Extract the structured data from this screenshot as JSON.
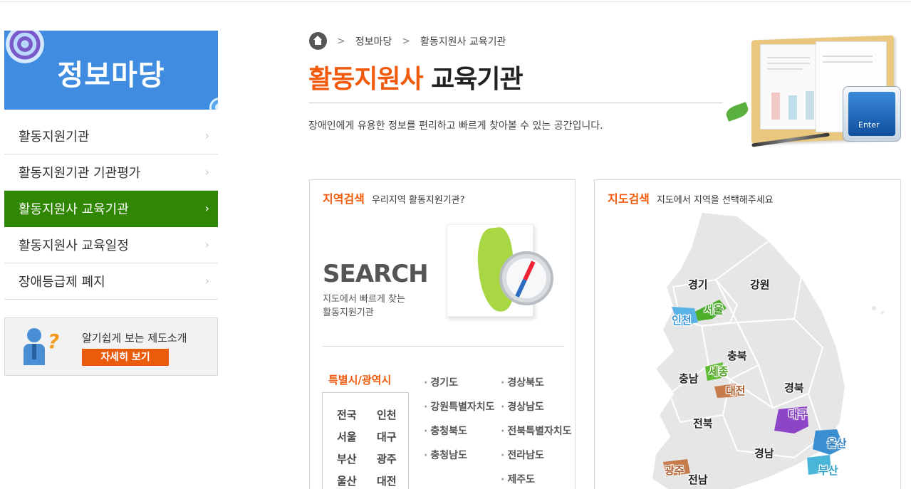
{
  "sidebar": {
    "banner_title": "정보마당",
    "menu": [
      {
        "label": "활동지원기관",
        "active": false
      },
      {
        "label": "활동지원기관 기관평가",
        "active": false
      },
      {
        "label": "활동지원사 교육기관",
        "active": true
      },
      {
        "label": "활동지원사 교육일정",
        "active": false
      },
      {
        "label": "장애등급제 폐지",
        "active": false
      }
    ],
    "arrow": "›",
    "promo": {
      "text": "알기쉽게 보는 제도소개",
      "button": "자세히 보기"
    }
  },
  "breadcrumb": {
    "items": [
      "정보마당",
      "활동지원사 교육기관"
    ],
    "separator": ">"
  },
  "page": {
    "title_highlight": "활동지원사",
    "title_rest": "교육기관",
    "description": "장애인에게 유용한 정보를 편리하고 빠르게 찾아볼 수 있는 공간입니다."
  },
  "illustration": {
    "enter_key": "Enter"
  },
  "region_search": {
    "heading": "지역검색",
    "subheading": "우리지역 활동지원기관?",
    "search_word": "SEARCH",
    "search_sub_line1": "지도에서 빠르게 찾는",
    "search_sub_line2": "활동지원기관",
    "metro_title": "특별시/광역시",
    "metro": [
      "전국",
      "인천",
      "서울",
      "대구",
      "부산",
      "광주",
      "울산",
      "대전"
    ],
    "provinces_col1": [
      "경기도",
      "강원특별자치도",
      "충청북도",
      "충청남도"
    ],
    "provinces_col2": [
      "경상북도",
      "경상남도",
      "전북특별자치도",
      "전라남도",
      "제주도"
    ]
  },
  "map_search": {
    "heading": "지도검색",
    "subheading": "지도에서 지역을 선택해주세요",
    "regions": {
      "gyeonggi": "경기",
      "gangwon": "강원",
      "seoul": "서울",
      "incheon": "인천",
      "chungbuk": "충북",
      "sejong": "세종",
      "chungnam": "충남",
      "daejeon": "대전",
      "gyeongbuk": "경북",
      "daegu": "대구",
      "jeonbuk": "전북",
      "ulsan": "울산",
      "gyeongnam": "경남",
      "busan": "부산",
      "gwangju": "광주",
      "jeonnam": "전남"
    },
    "colors": {
      "land": "#e6e6e6",
      "seoul": "#4caf2a",
      "incheon": "#59b3e6",
      "sejong": "#5dbb2e",
      "daejeon": "#c77a4a",
      "daegu": "#8e44c7",
      "ulsan": "#3a8fd1",
      "busan": "#49b6d9",
      "gwangju": "#c77a4a"
    }
  },
  "colors": {
    "accent": "#f15a0c",
    "active_menu": "#2f8703",
    "banner": "#3f8ce0"
  }
}
